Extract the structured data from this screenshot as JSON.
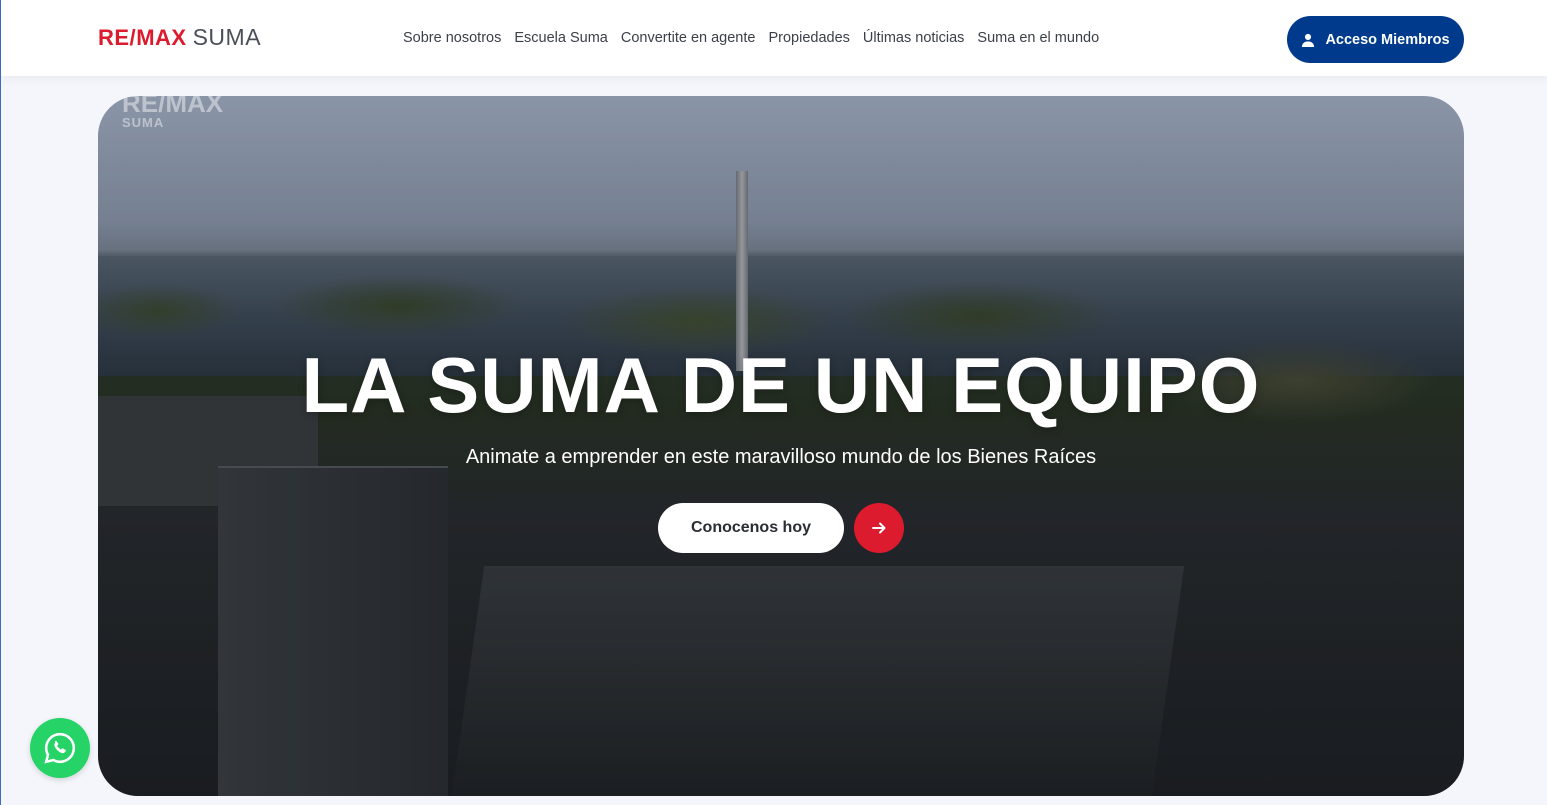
{
  "header": {
    "logo": {
      "part1": "RE/",
      "part2": "MAX",
      "part3": "SUMA"
    },
    "nav": [
      "Sobre nosotros",
      "Escuela Suma",
      "Convertite en agente",
      "Propiedades",
      "Últimas noticias",
      "Suma en el mundo"
    ],
    "member_button": "Acceso Miembros",
    "member_icon": "user-icon"
  },
  "hero": {
    "watermark_top": "RE/MAX",
    "watermark_bottom": "SUMA",
    "title": "LA SUMA DE UN EQUIPO",
    "subtitle": "Animate a emprender en este maravilloso mundo de los Bienes Raíces",
    "cta_label": "Conocenos hoy",
    "arrow_icon": "arrow-right-icon"
  },
  "floating": {
    "whatsapp_icon": "whatsapp-icon"
  },
  "colors": {
    "brand_red": "#dc1c2e",
    "brand_blue": "#003a8c",
    "whatsapp_green": "#25d366"
  }
}
